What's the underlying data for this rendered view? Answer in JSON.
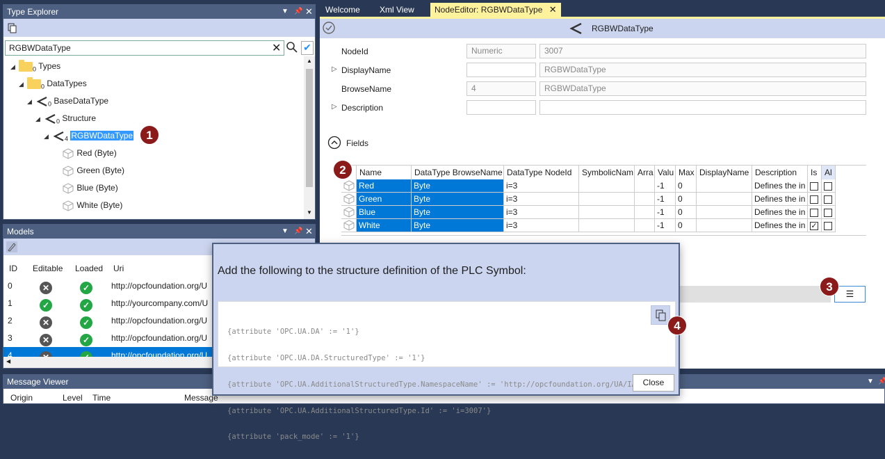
{
  "type_explorer": {
    "title": "Type Explorer",
    "search_value": "RGBWDataType",
    "tree": [
      {
        "label": "Types",
        "count": "0"
      },
      {
        "label": "DataTypes",
        "count": "0"
      },
      {
        "label": "BaseDataType",
        "count": "0"
      },
      {
        "label": "Structure",
        "count": "0"
      },
      {
        "label": "RGBWDataType",
        "count": "4"
      },
      {
        "label": "Red (Byte)"
      },
      {
        "label": "Green (Byte)"
      },
      {
        "label": "Blue (Byte)"
      },
      {
        "label": "White (Byte)"
      }
    ]
  },
  "models": {
    "title": "Models",
    "columns": [
      "ID",
      "Editable",
      "Loaded",
      "Uri"
    ],
    "rows": [
      {
        "id": "0",
        "uri": "http://opcfoundation.org/U"
      },
      {
        "id": "1",
        "uri": "http://yourcompany.com/U"
      },
      {
        "id": "2",
        "uri": "http://opcfoundation.org/U"
      },
      {
        "id": "3",
        "uri": "http://opcfoundation.org/U"
      },
      {
        "id": "4",
        "uri": "http://opcfoundation.org/U"
      }
    ]
  },
  "message_viewer": {
    "title": "Message Viewer",
    "columns": [
      "Origin",
      "Level",
      "Time",
      "Message"
    ]
  },
  "tabs": [
    "Welcome",
    "Xml View",
    "NodeEditor: RGBWDataType"
  ],
  "node_editor": {
    "title": "RGBWDataType",
    "labels": {
      "nodeid": "NodeId",
      "displayname": "DisplayName",
      "browsename": "BrowseName",
      "description": "Description"
    },
    "values": {
      "nodeid_type": "Numeric",
      "nodeid_value": "3007",
      "displayname_value": "RGBWDataType",
      "browsename_ns": "4",
      "browsename_value": "RGBWDataType"
    },
    "fields_label": "Fields",
    "grid_columns": [
      "Name",
      "DataType BrowseName",
      "DataType NodeId",
      "SymbolicNam",
      "Arra",
      "Valu",
      "Max",
      "DisplayName",
      "Description",
      "Is",
      "Al"
    ],
    "grid_rows": [
      {
        "name": "Red",
        "dt": "Byte",
        "nodeid": "i=3",
        "valu": "-1",
        "max": "0",
        "desc": "Defines the in"
      },
      {
        "name": "Green",
        "dt": "Byte",
        "nodeid": "i=3",
        "valu": "-1",
        "max": "0",
        "desc": "Defines the in"
      },
      {
        "name": "Blue",
        "dt": "Byte",
        "nodeid": "i=3",
        "valu": "-1",
        "max": "0",
        "desc": "Defines the in"
      },
      {
        "name": "White",
        "dt": "Byte",
        "nodeid": "i=3",
        "valu": "-1",
        "max": "0",
        "desc": "Defines the in"
      }
    ]
  },
  "dialog": {
    "heading": "Add the following to the structure definition of the PLC Symbol:",
    "code_lines": [
      "{attribute 'OPC.UA.DA' := '1'}",
      "{attribute 'OPC.UA.DA.StructuredType' := '1'}",
      "{attribute 'OPC.UA.AdditionalStructuredType.NamespaceName' := 'http://opcfoundation.org/UA/IA/'}",
      "{attribute 'OPC.UA.AdditionalStructuredType.Id' := 'i=3007'}",
      "{attribute 'pack_mode' := '1'}"
    ],
    "close_label": "Close"
  },
  "badges": [
    "1",
    "2",
    "3",
    "4"
  ],
  "colors": {
    "accent": "#0078d7",
    "badge": "#8b1a1a",
    "title_bar": "#4d6082",
    "tab_active": "#fff29d"
  }
}
